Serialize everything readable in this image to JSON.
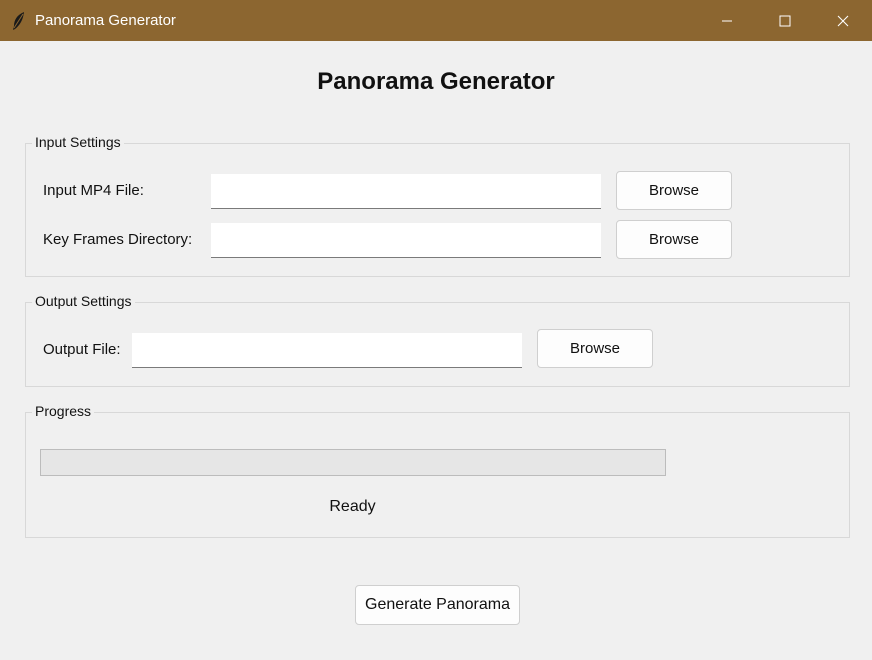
{
  "window": {
    "title": "Panorama Generator",
    "titlebar_color": "#8c6630",
    "icon": "feather-icon"
  },
  "heading": "Panorama Generator",
  "input_settings": {
    "title": "Input Settings",
    "mp4_label": "Input MP4 File:",
    "mp4_value": "",
    "keyframes_label": "Key Frames Directory:",
    "keyframes_value": "",
    "browse_label": "Browse"
  },
  "output_settings": {
    "title": "Output Settings",
    "output_label": "Output File:",
    "output_value": "",
    "browse_label": "Browse"
  },
  "progress": {
    "title": "Progress",
    "value": 0,
    "status": "Ready"
  },
  "generate_label": "Generate Panorama"
}
